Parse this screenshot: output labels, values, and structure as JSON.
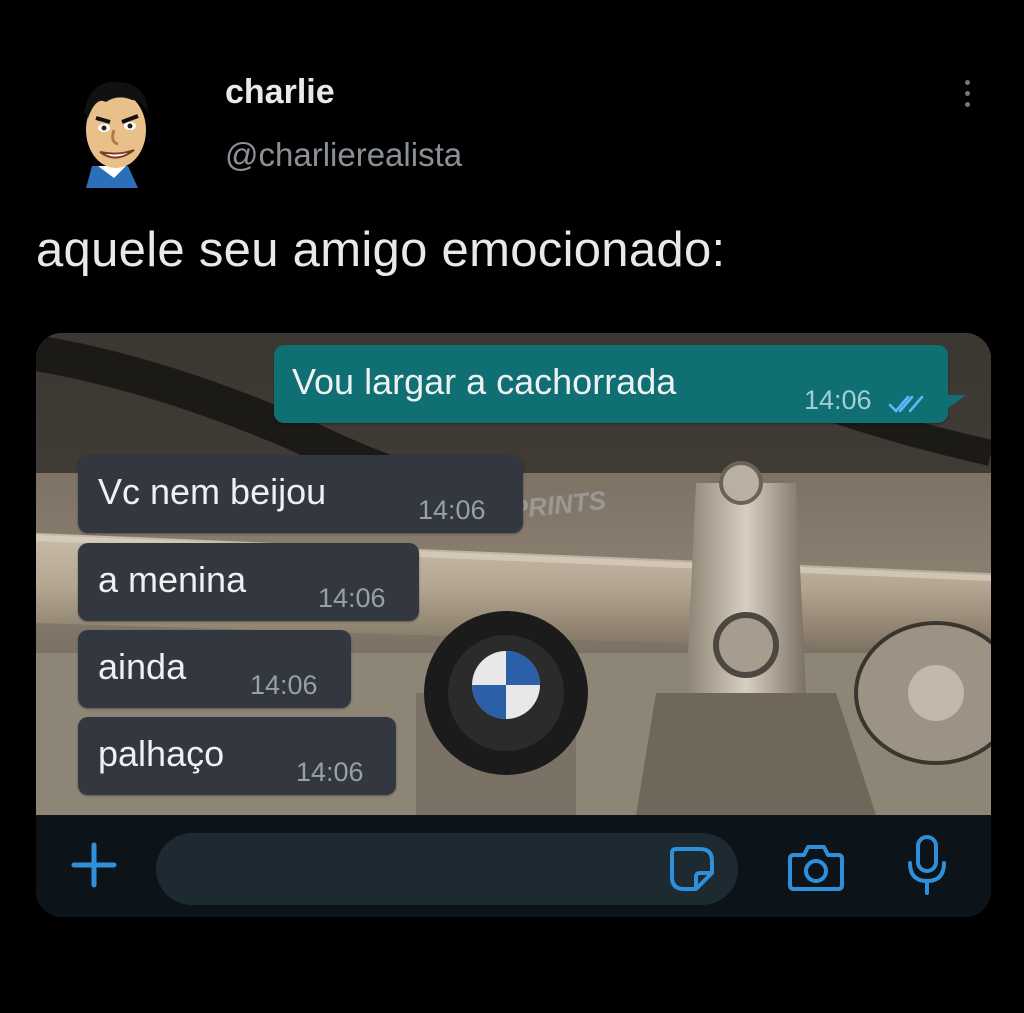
{
  "author": {
    "name": "charlie",
    "handle": "@charlierealista",
    "avatar_icon": "caricature-avatar"
  },
  "tweet": {
    "text": "aquele seu amigo emocionado:"
  },
  "media": {
    "outgoing": {
      "text": "Vou largar a cachorrada",
      "time": "14:06",
      "status_icon": "double-check-icon"
    },
    "incoming": [
      {
        "text": "Vc nem beijou",
        "time": "14:06"
      },
      {
        "text": "a menina",
        "time": "14:06"
      },
      {
        "text": "ainda",
        "time": "14:06"
      },
      {
        "text": "palhaço",
        "time": "14:06"
      }
    ],
    "watermark": "@OSPRINTS",
    "composer_icons": [
      "plus-icon",
      "sticker-icon",
      "camera-icon",
      "microphone-icon"
    ]
  },
  "colors": {
    "background": "#000000",
    "outgoing_bubble": "#106f73",
    "incoming_bubble": "#333840",
    "accent_icon": "#2f8fd9"
  }
}
